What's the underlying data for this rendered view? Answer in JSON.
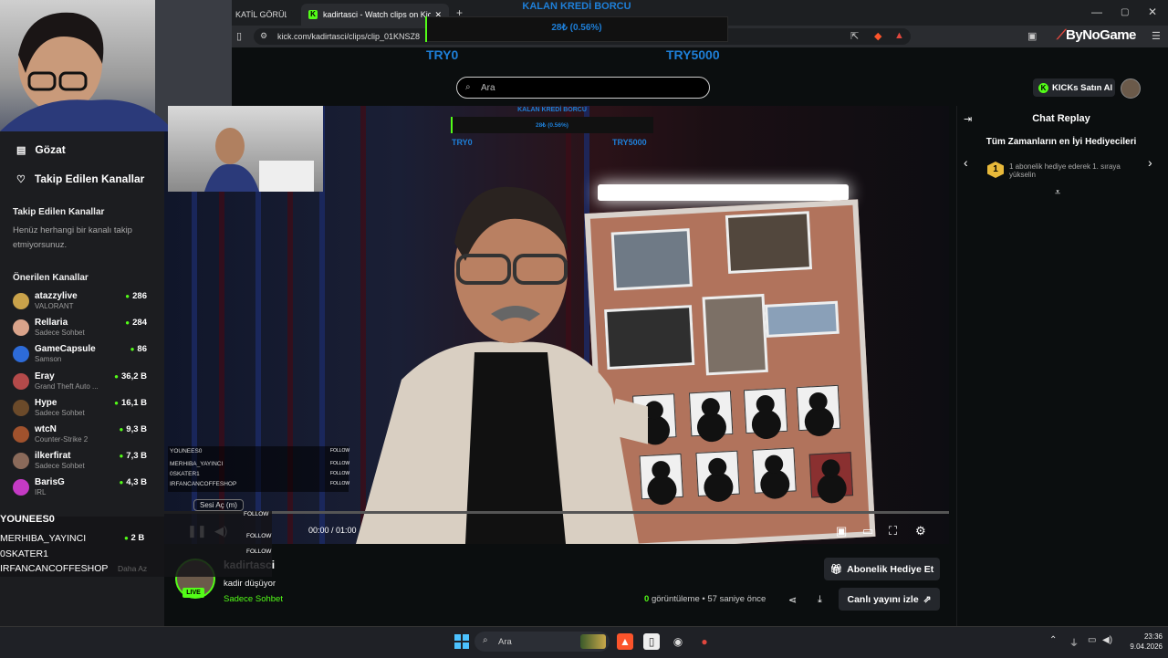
{
  "browser": {
    "tabs": [
      {
        "label": "KATİL GÖRÜLMEDİ"
      },
      {
        "label": "kadirtasci - Watch clips on Kick",
        "active": true
      }
    ],
    "url": "kick.com/kadirtasci/clips/clip_01KNSZ8"
  },
  "overlay": {
    "credit_title": "KALAN KREDİ BORCU",
    "credit_percent": "28₺ (0.56%)",
    "credit_fraction": 0.0056,
    "start_label": "TRY0",
    "end_label": "TRY5000",
    "brand": "ByNoGame",
    "events": [
      "YOUNEES0",
      "MERHIBA_YAYINCI",
      "0SKATER1",
      "IRFANCANCOFFESHOP"
    ],
    "follow_label": "FOLLOW"
  },
  "header": {
    "search_placeholder": "Ara",
    "kicks_button": "KICKs Satın Al"
  },
  "sidebar": {
    "browse": "Gözat",
    "following_link": "Takip Edilen Kanallar",
    "following_heading": "Takip Edilen Kanallar",
    "following_empty": "Henüz herhangi bir kanalı takip etmiyorsunuz.",
    "recommended_heading": "Önerilen Kanallar",
    "channels": [
      {
        "name": "atazzylive",
        "category": "VALORANT",
        "viewers": "286",
        "color": "#c9a24a"
      },
      {
        "name": "Rellaria",
        "category": "Sadece Sohbet",
        "viewers": "284",
        "color": "#d9a38a"
      },
      {
        "name": "GameCapsule",
        "category": "Samson",
        "viewers": "86",
        "color": "#2d6bd8"
      },
      {
        "name": "Eray",
        "category": "Grand Theft Auto ...",
        "viewers": "36,2 B",
        "color": "#b44a4a"
      },
      {
        "name": "Hype",
        "category": "Sadece Sohbet",
        "viewers": "16,1 B",
        "color": "#6b4a2a"
      },
      {
        "name": "wtcN",
        "category": "Counter-Strike 2",
        "viewers": "9,3 B",
        "color": "#a0522d"
      },
      {
        "name": "ilkerfirat",
        "category": "Sadece Sohbet",
        "viewers": "7,3 B",
        "color": "#8a6a5a"
      },
      {
        "name": "BarisG",
        "category": "IRL",
        "viewers": "4,3 B",
        "color": "#c43ac4"
      }
    ],
    "peek_viewers": "2 B",
    "show_less": "Daha Az"
  },
  "player": {
    "sound_button": "Sesi Aç (m)",
    "time": "00:00 / 01:00"
  },
  "clip": {
    "streamer": "kadirtasci",
    "title": "kadir düşüyor",
    "category": "Sadece Sohbet",
    "live_badge": "LIVE",
    "views_count": "0",
    "views_label": "görüntüleme",
    "age": "57 saniye önce",
    "gift_button": "Abonelik Hediye Et",
    "watch_live_button": "Canlı yayını izle"
  },
  "chat": {
    "title": "Chat Replay",
    "gifters_title": "Tüm Zamanların en İyi Hediyecileri",
    "rank": "1",
    "rank_text": "1 abonelik hediye ederek 1. sıraya yükselin"
  },
  "taskbar": {
    "search_placeholder": "Ara",
    "time": "23:36",
    "date": "9.04.2026"
  }
}
